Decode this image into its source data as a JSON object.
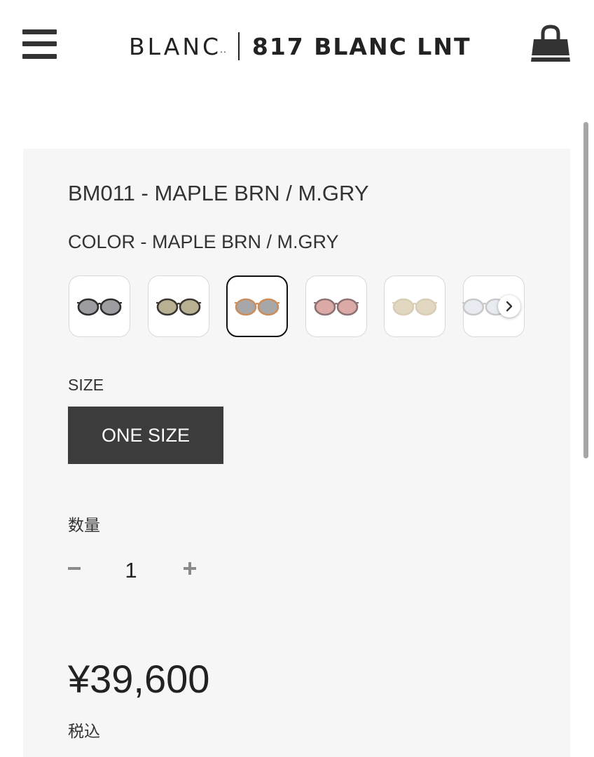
{
  "header": {
    "brand": "BLANC",
    "brand_dots": "..",
    "store_name": "817 BLANC LNT",
    "menu_icon": "hamburger-menu-icon",
    "cart_icon": "shopping-bag-icon"
  },
  "product": {
    "name": "BM011 - MAPLE BRN / M.GRY",
    "color_label": "COLOR - MAPLE BRN / M.GRY",
    "swatches": [
      {
        "frame": "#2e2e2e",
        "lens": "#9c9ca1",
        "selected": false
      },
      {
        "frame": "#3a3530",
        "lens": "#b8b092",
        "selected": false
      },
      {
        "frame": "#c98e5e",
        "lens": "#a7a7aa",
        "selected": true
      },
      {
        "frame": "#8c7272",
        "lens": "#dcaaa6",
        "selected": false
      },
      {
        "frame": "#d8cdb5",
        "lens": "#e2d8c2",
        "selected": false
      },
      {
        "frame": "#c8c8c8",
        "lens": "#e8ecf2",
        "selected": false
      }
    ],
    "swatch_next_icon": "chevron-right-icon",
    "size_label": "SIZE",
    "size_option": "ONE SIZE",
    "quantity_label": "数量",
    "quantity": "1",
    "price": "¥39,600",
    "tax_note": "税込"
  }
}
